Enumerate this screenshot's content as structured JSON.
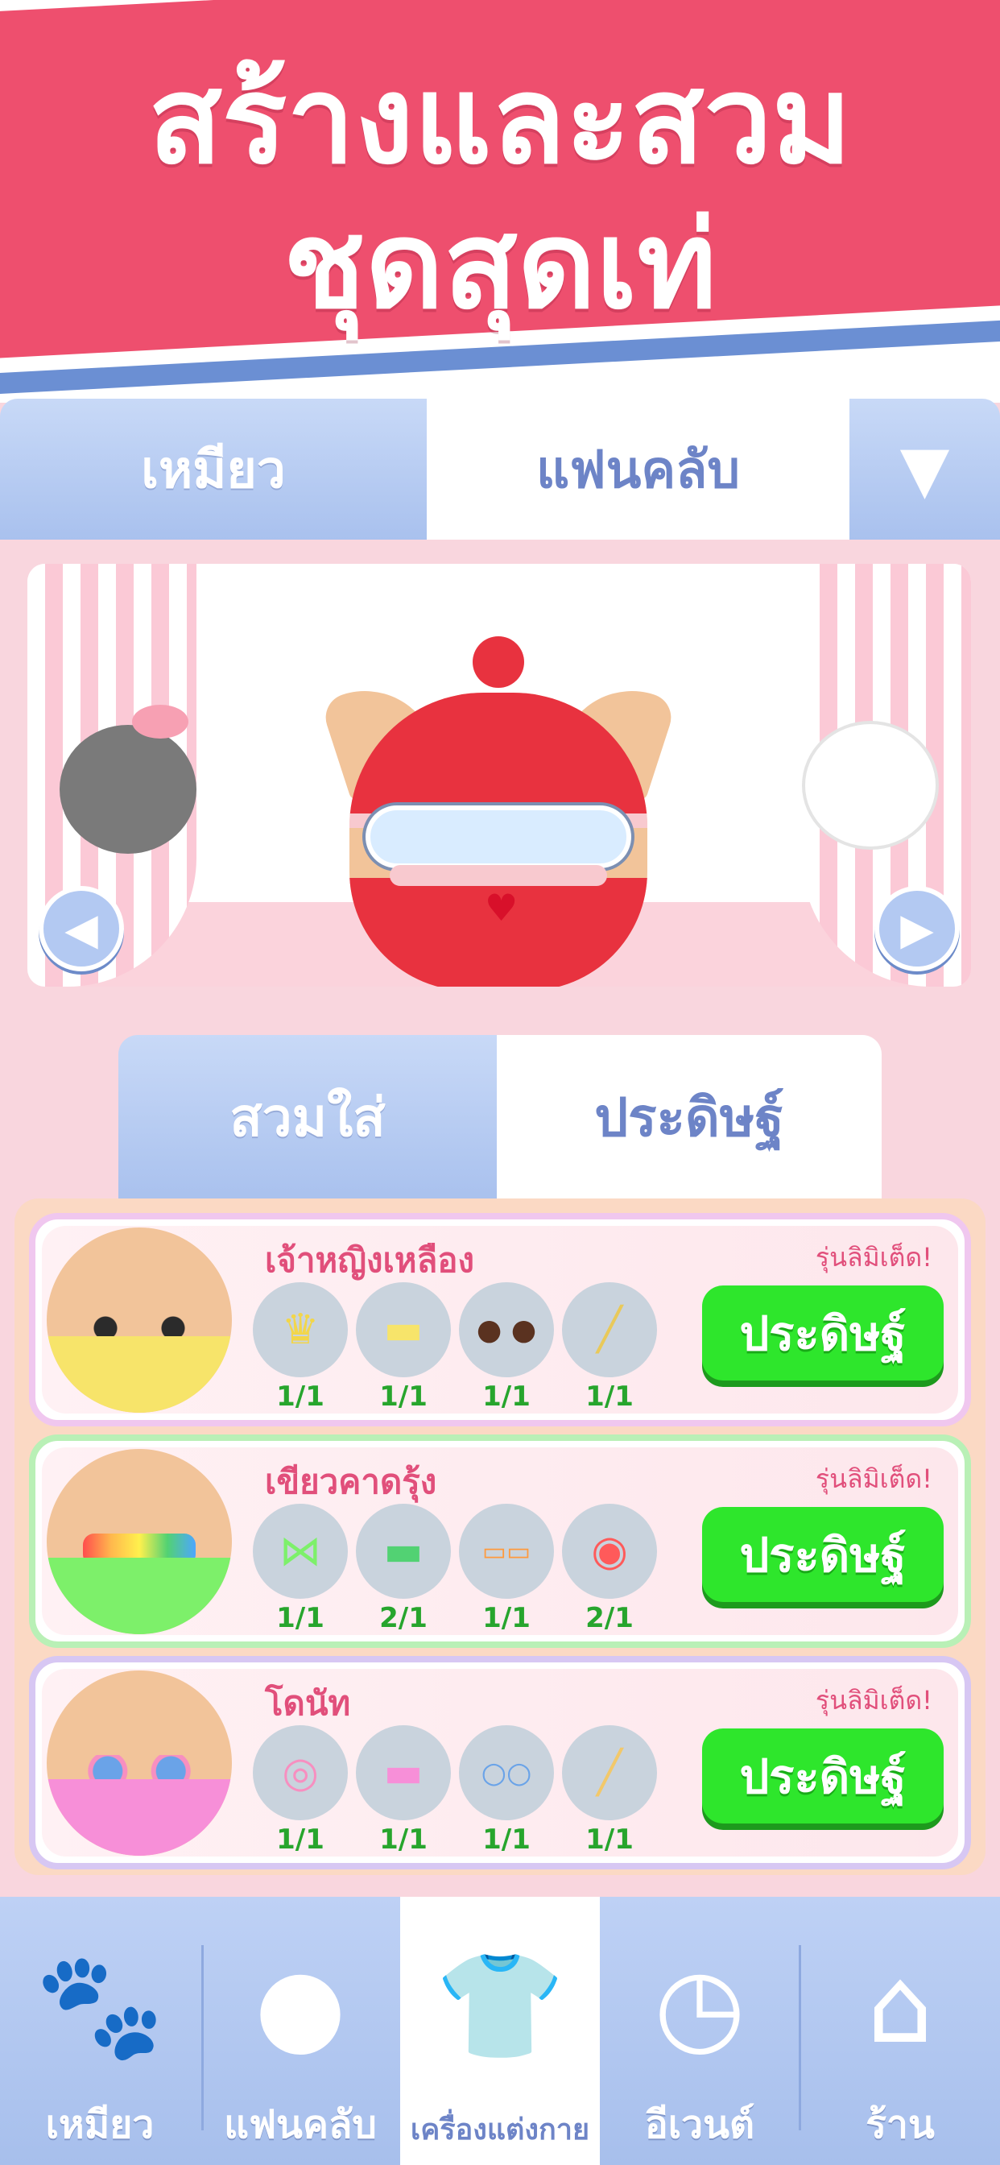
{
  "banner": {
    "line1": "สร้างและสวม",
    "line2": "ชุดสุดเท่"
  },
  "top_tabs": [
    {
      "label": "เหมียว",
      "active": false
    },
    {
      "label": "แฟนคลับ",
      "active": true
    }
  ],
  "dropdown_symbol": "▼",
  "stage": {
    "prev_symbol": "◀",
    "next_symbol": "▶"
  },
  "mode_tabs": [
    {
      "label": "สวมใส่",
      "active": false
    },
    {
      "label": "ประดิษฐ์",
      "active": true
    }
  ],
  "outfits": [
    {
      "name": "เจ้าหญิงเหลือง",
      "limited_label": "รุ่นลิมิเต็ด!",
      "button_label": "ประดิษฐ์",
      "parts": [
        {
          "icon": "crown-icon",
          "glyph": "♛",
          "count": "1/1"
        },
        {
          "icon": "top-icon",
          "glyph": "▬",
          "count": "1/1"
        },
        {
          "icon": "eyes-icon",
          "glyph": "● ●",
          "count": "1/1"
        },
        {
          "icon": "wand-icon",
          "glyph": "╱",
          "count": "1/1"
        }
      ]
    },
    {
      "name": "เขียวคาดรุ้ง",
      "limited_label": "รุ่นลิมิเต็ด!",
      "button_label": "ประดิษฐ์",
      "parts": [
        {
          "icon": "bow-icon",
          "glyph": "⋈",
          "count": "1/1"
        },
        {
          "icon": "top-icon",
          "glyph": "▬",
          "count": "2/1"
        },
        {
          "icon": "glasses-icon",
          "glyph": "▭▭",
          "count": "1/1"
        },
        {
          "icon": "lollipop-icon",
          "glyph": "◉",
          "count": "2/1"
        }
      ]
    },
    {
      "name": "โดนัท",
      "limited_label": "รุ่นลิมิเต็ด!",
      "button_label": "ประดิษฐ์",
      "parts": [
        {
          "icon": "donut-icon",
          "glyph": "◎",
          "count": "1/1"
        },
        {
          "icon": "top-icon",
          "glyph": "▬",
          "count": "1/1"
        },
        {
          "icon": "glasses-icon",
          "glyph": "○○",
          "count": "1/1"
        },
        {
          "icon": "wand-icon",
          "glyph": "╱",
          "count": "1/1"
        }
      ]
    }
  ],
  "bottom_nav": [
    {
      "label": "เหมียว",
      "icon": "paw-icon",
      "glyph": "🐾",
      "active": false
    },
    {
      "label": "แฟนคลับ",
      "icon": "cat-head-icon",
      "glyph": "●",
      "active": false
    },
    {
      "label": "เครื่องแต่งกาย",
      "icon": "shirt-icon",
      "glyph": "👕",
      "active": true
    },
    {
      "label": "อีเวนต์",
      "icon": "clock-icon",
      "glyph": "◷",
      "active": false
    },
    {
      "label": "ร้าน",
      "icon": "shop-icon",
      "glyph": "⌂",
      "active": false
    }
  ],
  "colors": {
    "banner": "#ee4f6e",
    "accent_blue": "#6d84c7",
    "button_green": "#2ee62c",
    "count_green": "#27a52d",
    "name_pink": "#e14f7b"
  }
}
